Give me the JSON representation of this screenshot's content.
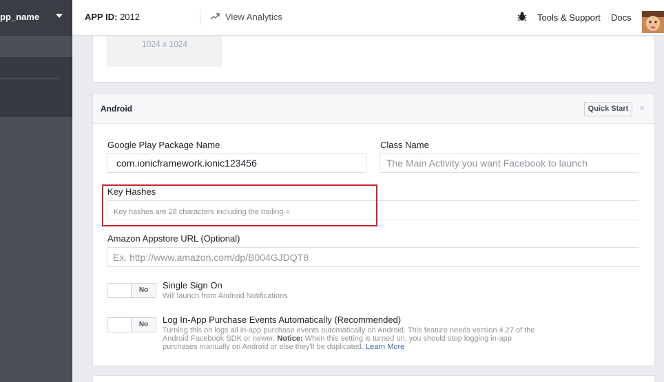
{
  "sidebar": {
    "app_name": "pp_name"
  },
  "topbar": {
    "app_id_label": "APP ID:",
    "app_id_value": "2012",
    "view_analytics": "View Analytics",
    "tools_support": "Tools & Support",
    "docs": "Docs"
  },
  "icon_card": {
    "size_label": "1024 x 1024"
  },
  "android": {
    "title": "Android",
    "quick_start": "Quick Start",
    "close_glyph": "×",
    "package_label": "Google Play Package Name",
    "package_value": "com.ionicframework.ionic123456",
    "class_label": "Class Name",
    "class_placeholder": "The Main Activity you want Facebook to launch",
    "key_hashes_label": "Key Hashes",
    "key_hashes_placeholder": "Key hashes are 28 characters including the trailing =",
    "amazon_label": "Amazon Appstore URL (Optional)",
    "amazon_placeholder": "Ex. http://www.amazon.com/dp/B004GJDQT8",
    "sso": {
      "toggle": "No",
      "title": "Single Sign On",
      "desc": "Will launch from Android Notifications"
    },
    "iap": {
      "toggle": "No",
      "title": "Log In-App Purchase Events Automatically (Recommended)",
      "desc_line1": "Turning this on logs all in-app purchase events automatically on Android. This feature needs version 4.27 of the",
      "desc_line2_a": "Android Facebook SDK or newer.",
      "desc_line2_notice": "Notice:",
      "desc_line2_b": "When this setting is turned on, you should stop logging in-app",
      "desc_line3": "purchases manually on Android or else they'll be duplicated.",
      "learn_more": "Learn More"
    }
  },
  "colors": {
    "sidebar_bg": "#4b4f56",
    "sidebar_active": "#373a41",
    "highlight": "#c7242c",
    "link": "#4267b2"
  }
}
